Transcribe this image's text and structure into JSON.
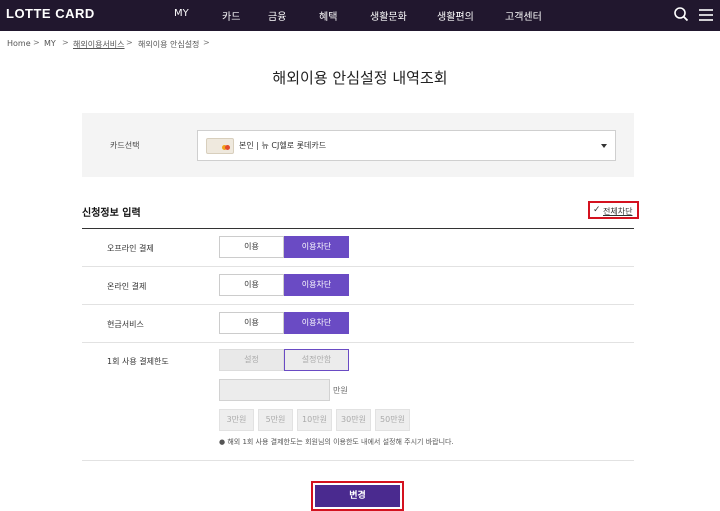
{
  "header": {
    "logo": "LOTTE CARD",
    "nav": [
      "MY",
      "카드",
      "금융",
      "혜택",
      "생활문화",
      "생활편의",
      "고객센터"
    ]
  },
  "breadcrumb": [
    "Home",
    "MY",
    "해외이용서비스",
    "해외이용 안심설정"
  ],
  "page_title": "해외이용 안심설정 내역조회",
  "card_select": {
    "label": "카드선택",
    "value": "본인 | 뉴 CJ헬로 롯데카드"
  },
  "section": {
    "title": "신청정보 입력",
    "block_all": "전체차단"
  },
  "rows": [
    {
      "label": "오프라인 결제",
      "options": [
        "이용",
        "이용차단"
      ],
      "selected": "이용차단"
    },
    {
      "label": "온라인 결제",
      "options": [
        "이용",
        "이용차단"
      ],
      "selected": "이용차단"
    },
    {
      "label": "현금서비스",
      "options": [
        "이용",
        "이용차단"
      ],
      "selected": "이용차단"
    }
  ],
  "limit": {
    "label": "1회 사용 결제한도",
    "options": [
      "설정",
      "설정안함"
    ],
    "selected": "설정안함",
    "input_value": "",
    "unit": "만원",
    "amounts": [
      "3만원",
      "5만원",
      "10만원",
      "30만원",
      "50만원"
    ],
    "note": "● 해외 1회 사용 결제한도는 회원님의 이용한도 내에서 설정해 주시기 바랍니다."
  },
  "submit_label": "변경",
  "colors": {
    "nav_bg": "#21172e",
    "accent_purple": "#6a4bc4",
    "submit_purple": "#4a2a8f",
    "highlight_red": "#d4121f"
  }
}
